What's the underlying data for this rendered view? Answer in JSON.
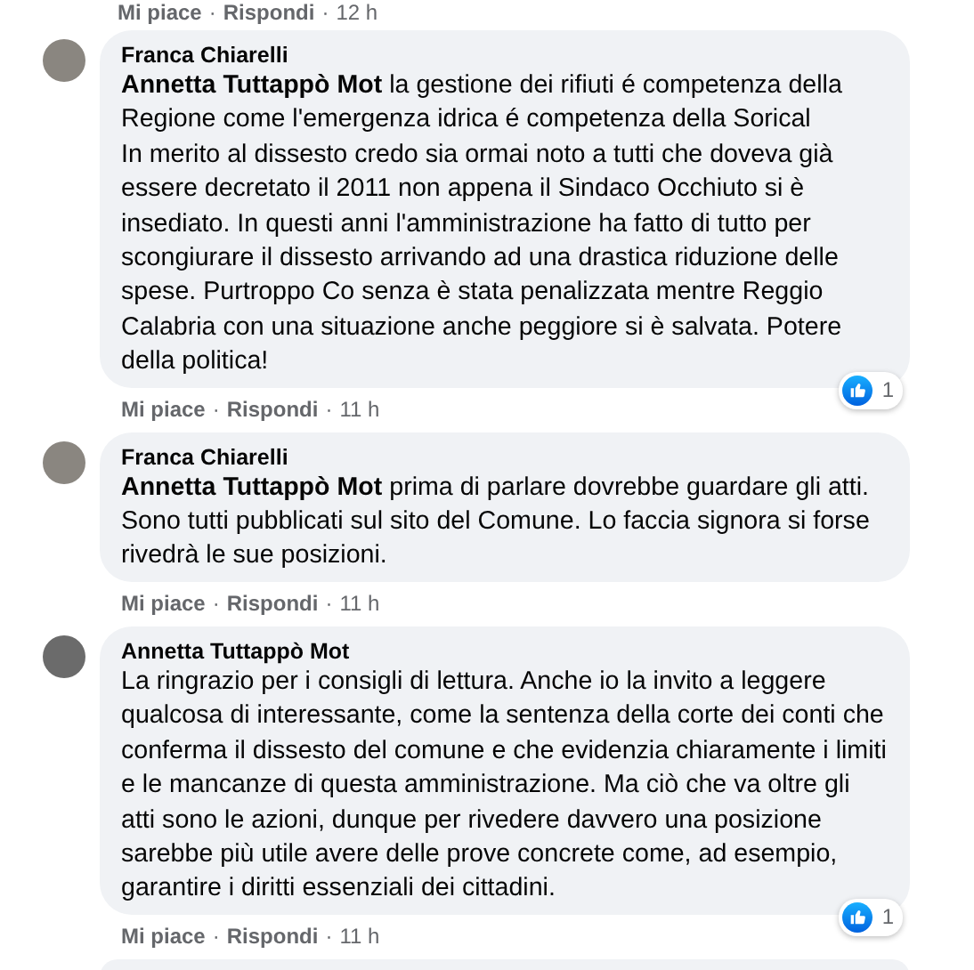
{
  "top_actions": {
    "like": "Mi piace",
    "sep": "·",
    "reply": "Rispondi",
    "time": "12 h"
  },
  "comments": [
    {
      "author": "Franca Chiarelli",
      "text": "**Annetta Tuttappò Mot** la gestione dei rifiuti é competenza della Regione come l'emergenza idrica é competenza della Sorical\nIn merito al dissesto credo sia ormai noto a tutti che doveva già essere decretato il 2011 non appena il Sindaco Occhiuto si è insediato. In questi anni l'amministrazione ha fatto di tutto per scongiurare il dissesto arrivando ad una drastica riduzione delle spese. Purtroppo Co senza è stata penalizzata mentre Reggio Calabria con una situazione anche peggiore si è salvata. Potere della politica!",
      "reactions": "1",
      "like": "Mi piace",
      "sep": "·",
      "reply": "Rispondi",
      "time": "11 h"
    },
    {
      "author": "Franca Chiarelli",
      "text": "**Annetta Tuttappò Mot** prima di parlare dovrebbe guardare gli atti. Sono tutti pubblicati sul sito del Comune. Lo faccia signora si forse rivedrà le sue posizioni.",
      "like": "Mi piace",
      "sep": "·",
      "reply": "Rispondi",
      "time": "11 h"
    },
    {
      "author": "Annetta Tuttappò Mot",
      "text": "La ringrazio per i consigli di lettura. Anche io la invito a leggere qualcosa di interessante, come la sentenza della corte dei conti che conferma il dissesto del comune e che evidenzia chiaramente i limiti e le mancanze di questa amministrazione. Ma ciò che va oltre gli atti sono le azioni, dunque per rivedere davvero una posizione sarebbe più utile avere delle prove concrete come, ad esempio, garantire i diritti essenziali dei cittadini.",
      "reactions": "1",
      "like": "Mi piace",
      "sep": "·",
      "reply": "Rispondi",
      "time": "11 h"
    }
  ]
}
